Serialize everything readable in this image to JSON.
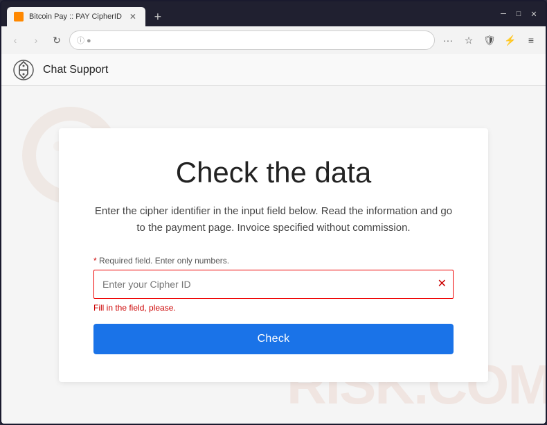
{
  "browser": {
    "tab": {
      "title": "Bitcoin Pay :: PAY CipherID",
      "favicon": "₿"
    },
    "address": {
      "url": "⊙ ●",
      "url_text": ""
    },
    "window_controls": {
      "minimize": "─",
      "maximize": "□",
      "close": "✕"
    }
  },
  "nav": {
    "logo_alt": "Bitcoin Pay Logo",
    "title": "Chat Support"
  },
  "main": {
    "heading": "Check the data",
    "description": "Enter the cipher identifier in the input field below. Read the information and go to the payment page. Invoice specified without commission.",
    "required_note": "* Required field. Enter only numbers.",
    "required_star": "*",
    "required_text": " Required field. Enter only numbers.",
    "input_placeholder": "Enter your Cipher ID",
    "error_text": "Fill in the field, please.",
    "check_button": "Check",
    "watermark": "RISK.COM"
  },
  "toolbar": {
    "back": "‹",
    "forward": "›",
    "refresh": "↻",
    "more": "···",
    "bookmark": "☆",
    "shield": "🛡",
    "lightning": "⚡",
    "menu": "≡"
  }
}
